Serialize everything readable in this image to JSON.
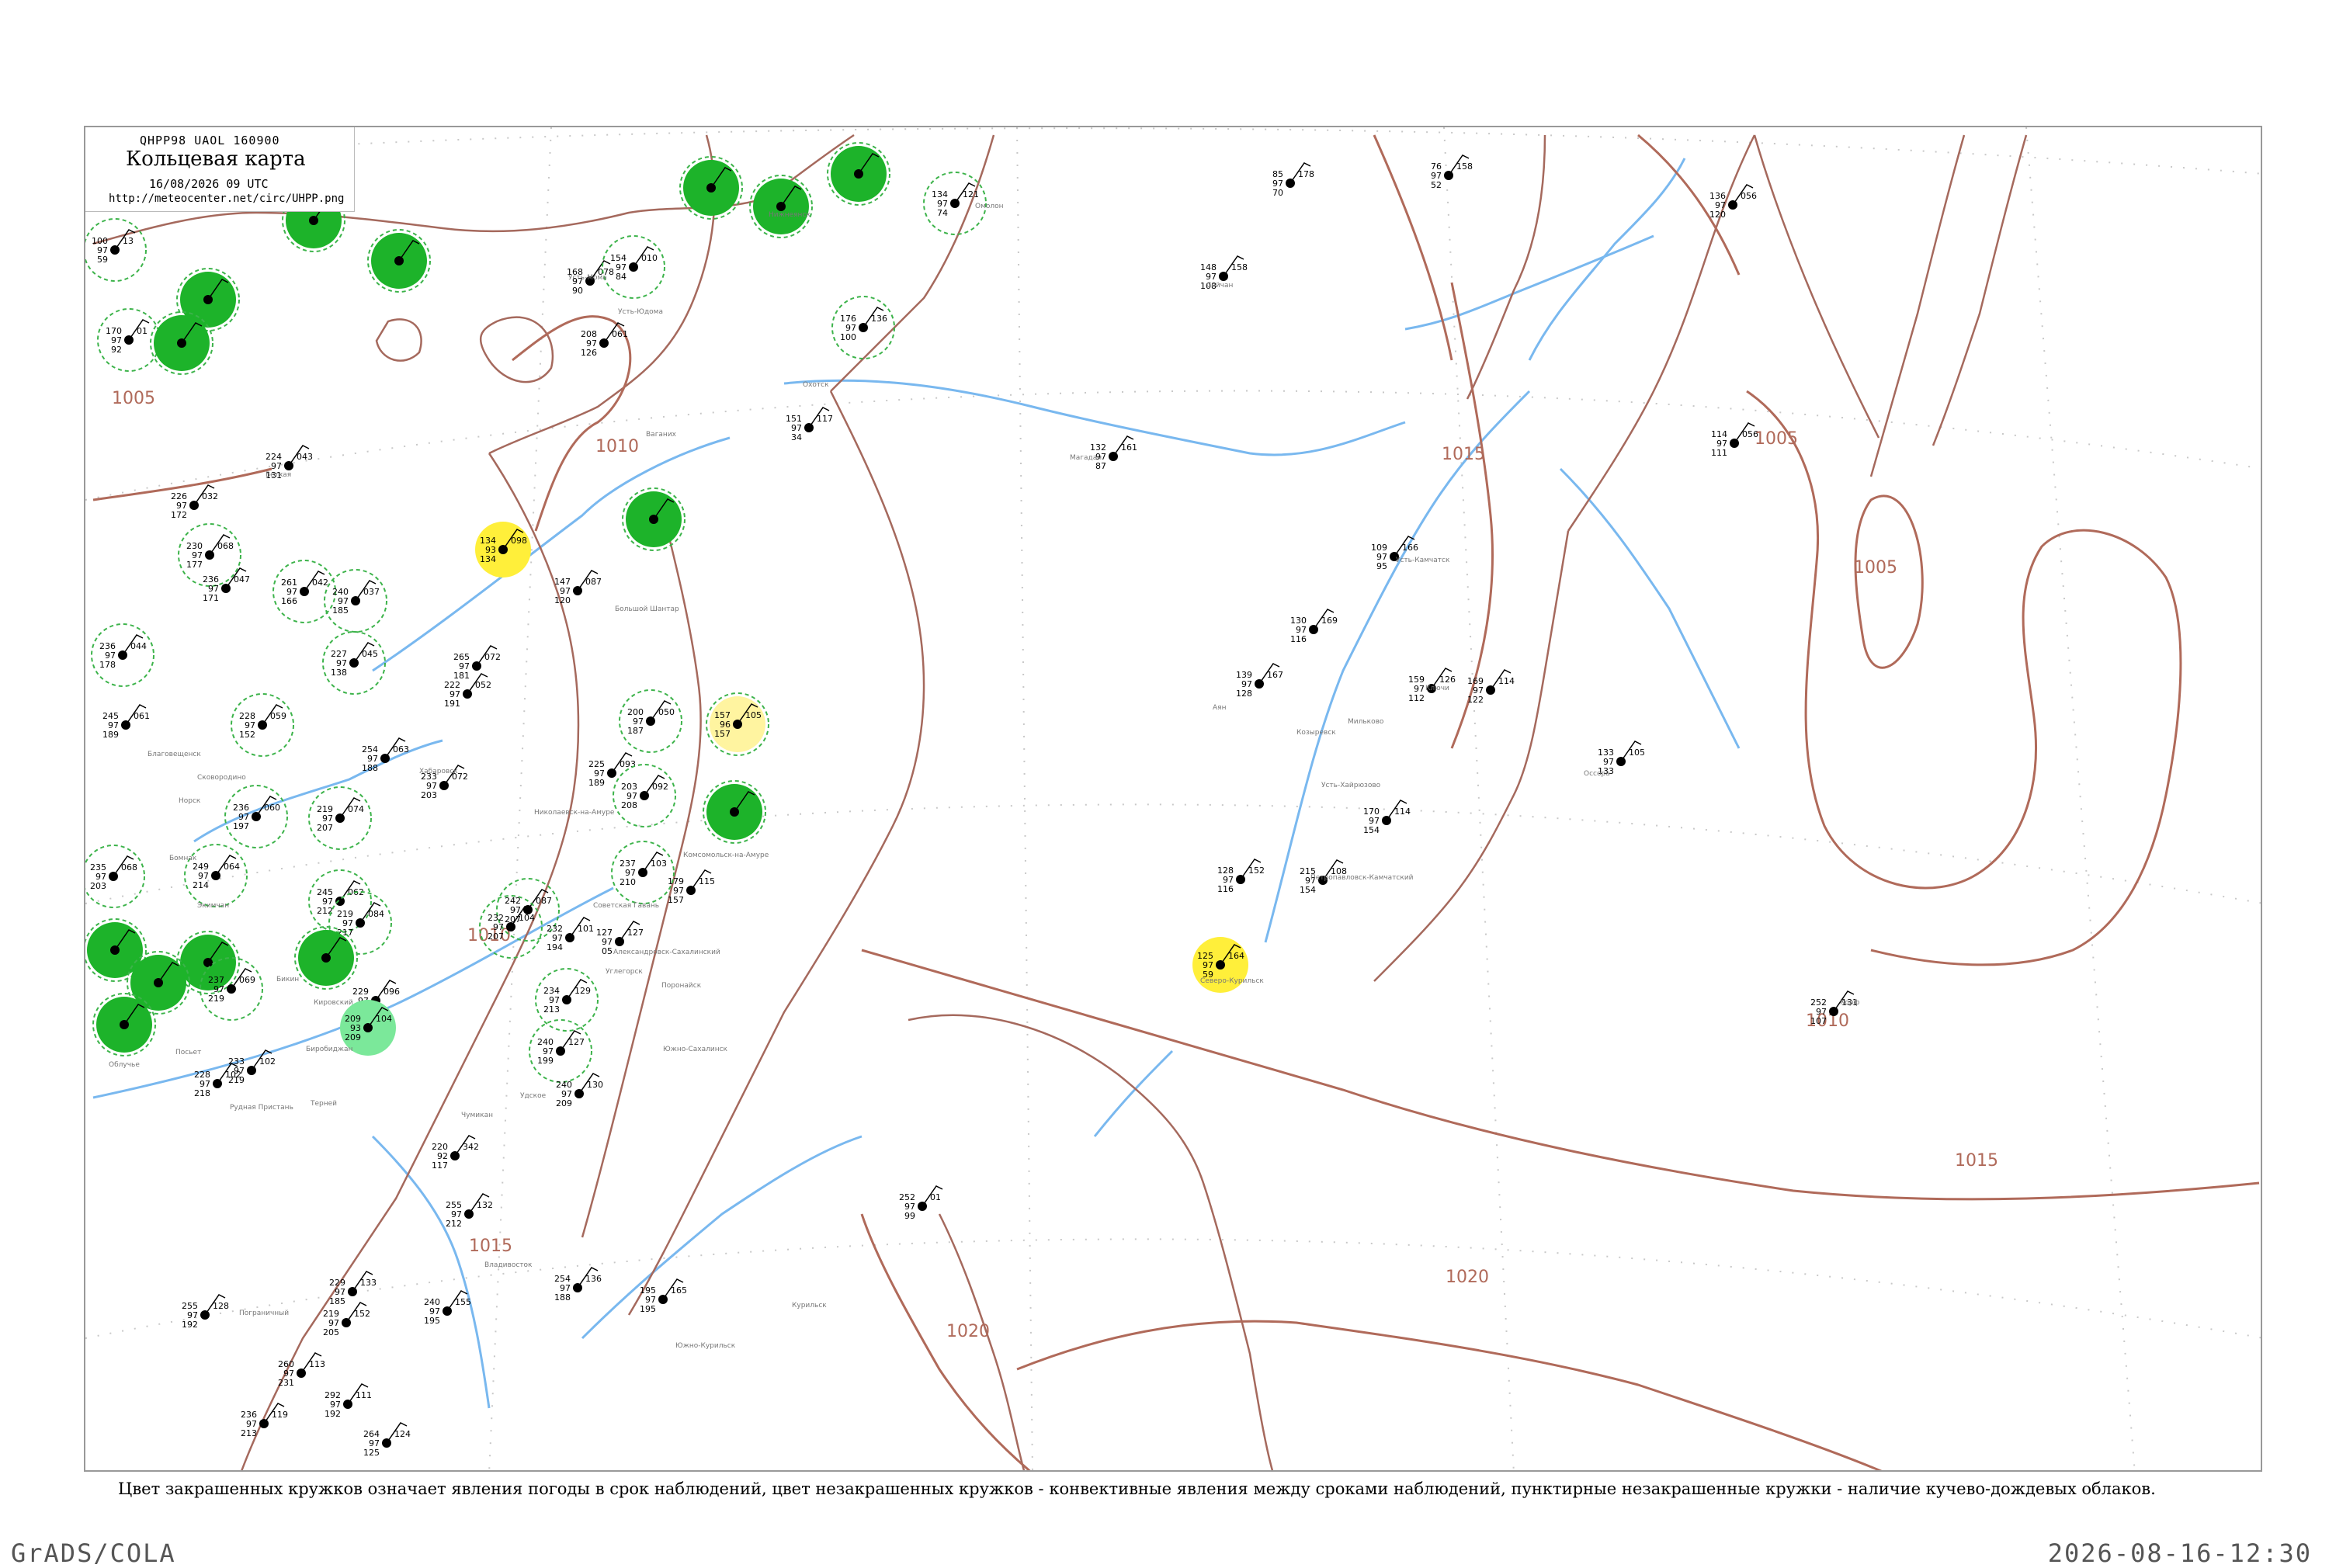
{
  "header": {
    "code": "QHPP98  UAOL  160900",
    "title": "Кольцевая карта",
    "datetime": "16/08/2026 09 UTC",
    "url": "http://meteocenter.net/circ/UHPP.png"
  },
  "caption": "Цвет закрашенных кружков означает явления погоды в срок наблюдений, цвет незакрашенных кружков - конвективные явления между сроками наблюдений, пунктирные незакрашенные кружки - наличие кучево-дождевых облаков.",
  "footer": {
    "left": "GrADS/COLA",
    "right": "2026-08-16-12:30"
  },
  "colors": {
    "frame": "#999999",
    "isobar": "#b06a5a",
    "coast": "#a5695d",
    "river": "#79b8ef",
    "grid": "#c8c8c8",
    "green_fill": "#1db32a",
    "yellow_fill": "#ffef3a",
    "light_green_fill": "#7be89a",
    "light_yellow_fill": "#fff4a0",
    "cb_ring": "#3cb34a"
  },
  "isobar_labels": [
    "1005",
    "1010",
    "1010",
    "1015",
    "1015",
    "1005",
    "1005",
    "1010",
    "1015",
    "1020",
    "1020"
  ],
  "stations": [
    {
      "t": "100",
      "w": "13",
      "h": "97",
      "v": "59",
      "fill": "none",
      "ring": "cb"
    },
    {
      "t": "170",
      "w": "01",
      "h": "97",
      "v": "92",
      "fill": "none",
      "ring": "cb"
    },
    {
      "t": "",
      "w": "",
      "h": "",
      "v": "",
      "fill": "green",
      "ring": "cb"
    },
    {
      "t": "",
      "w": "",
      "h": "",
      "v": "",
      "fill": "green",
      "ring": "cb"
    },
    {
      "t": "",
      "w": "",
      "h": "",
      "v": "",
      "fill": "green",
      "ring": "cb"
    },
    {
      "t": "134",
      "w": "121",
      "h": "97",
      "v": "74",
      "fill": "none",
      "ring": "cb"
    },
    {
      "t": "",
      "w": "",
      "h": "",
      "v": "",
      "fill": "green",
      "ring": "cb"
    },
    {
      "t": "",
      "w": "",
      "h": "",
      "v": "",
      "fill": "green",
      "ring": "cb"
    },
    {
      "t": "",
      "w": "",
      "h": "",
      "v": "",
      "fill": "green",
      "ring": "cb"
    },
    {
      "t": "",
      "w": "",
      "h": "",
      "v": "",
      "fill": "green",
      "ring": "cb"
    },
    {
      "t": "168",
      "w": "078",
      "h": "97",
      "v": "90",
      "fill": "none",
      "ring": "none"
    },
    {
      "t": "154",
      "w": "010",
      "h": "97",
      "v": "84",
      "fill": "none",
      "ring": "cb"
    },
    {
      "t": "208",
      "w": "061",
      "h": "97",
      "v": "126",
      "fill": "none",
      "ring": "none"
    },
    {
      "t": "176",
      "w": "136",
      "h": "97",
      "v": "100",
      "fill": "none",
      "ring": "cb"
    },
    {
      "t": "151",
      "w": "117",
      "h": "97",
      "v": "34",
      "fill": "none",
      "ring": "none"
    },
    {
      "t": "85",
      "w": "178",
      "h": "97",
      "v": "70",
      "fill": "none",
      "ring": "none"
    },
    {
      "t": "76",
      "w": "158",
      "h": "97",
      "v": "52",
      "fill": "none",
      "ring": "none"
    },
    {
      "t": "136",
      "w": "056",
      "h": "97",
      "v": "120",
      "fill": "none",
      "ring": "none"
    },
    {
      "t": "148",
      "w": "158",
      "h": "97",
      "v": "108",
      "fill": "none",
      "ring": "none"
    },
    {
      "t": "132",
      "w": "161",
      "h": "97",
      "v": "87",
      "fill": "none",
      "ring": "none"
    },
    {
      "t": "114",
      "w": "056",
      "h": "97",
      "v": "111",
      "fill": "none",
      "ring": "none"
    },
    {
      "t": "226",
      "w": "032",
      "h": "97",
      "v": "172",
      "fill": "none",
      "ring": "none"
    },
    {
      "t": "224",
      "w": "043",
      "h": "97",
      "v": "131",
      "fill": "none",
      "ring": "none"
    },
    {
      "t": "134",
      "w": "098",
      "h": "93",
      "v": "134",
      "fill": "yellow",
      "ring": "none"
    },
    {
      "t": "",
      "w": "",
      "h": "",
      "v": "",
      "fill": "green",
      "ring": "cb"
    },
    {
      "t": "147",
      "w": "087",
      "h": "97",
      "v": "120",
      "fill": "none",
      "ring": "none"
    },
    {
      "t": "230",
      "w": "068",
      "h": "97",
      "v": "177",
      "fill": "none",
      "ring": "cb"
    },
    {
      "t": "236",
      "w": "047",
      "h": "97",
      "v": "171",
      "fill": "none",
      "ring": "none"
    },
    {
      "t": "261",
      "w": "042",
      "h": "97",
      "v": "166",
      "fill": "none",
      "ring": "cb"
    },
    {
      "t": "240",
      "w": "037",
      "h": "97",
      "v": "185",
      "fill": "none",
      "ring": "cb"
    },
    {
      "t": "236",
      "w": "044",
      "h": "97",
      "v": "178",
      "fill": "none",
      "ring": "cb"
    },
    {
      "t": "227",
      "w": "045",
      "h": "97",
      "v": "138",
      "fill": "none",
      "ring": "cb"
    },
    {
      "t": "265",
      "w": "072",
      "h": "97",
      "v": "181",
      "fill": "none",
      "ring": "none"
    },
    {
      "t": "222",
      "w": "052",
      "h": "97",
      "v": "191",
      "fill": "none",
      "ring": "none"
    },
    {
      "t": "109",
      "w": "166",
      "h": "97",
      "v": "95",
      "fill": "none",
      "ring": "none"
    },
    {
      "t": "130",
      "w": "169",
      "h": "97",
      "v": "116",
      "fill": "none",
      "ring": "none"
    },
    {
      "t": "159",
      "w": "126",
      "h": "97",
      "v": "112",
      "fill": "none",
      "ring": "none"
    },
    {
      "t": "169",
      "w": "114",
      "h": "97",
      "v": "122",
      "fill": "none",
      "ring": "none"
    },
    {
      "t": "139",
      "w": "167",
      "h": "97",
      "v": "128",
      "fill": "none",
      "ring": "none"
    },
    {
      "t": "200",
      "w": "050",
      "h": "97",
      "v": "187",
      "fill": "none",
      "ring": "cb"
    },
    {
      "t": "157",
      "w": "105",
      "h": "96",
      "v": "157",
      "fill": "light-yellow",
      "ring": "cb"
    },
    {
      "t": "133",
      "w": "105",
      "h": "97",
      "v": "133",
      "fill": "none",
      "ring": "none"
    },
    {
      "t": "228",
      "w": "059",
      "h": "97",
      "v": "152",
      "fill": "none",
      "ring": "cb"
    },
    {
      "t": "254",
      "w": "063",
      "h": "97",
      "v": "188",
      "fill": "none",
      "ring": "none"
    },
    {
      "t": "225",
      "w": "093",
      "h": "97",
      "v": "189",
      "fill": "none",
      "ring": "none"
    },
    {
      "t": "203",
      "w": "092",
      "h": "97",
      "v": "208",
      "fill": "none",
      "ring": "cb"
    },
    {
      "t": "233",
      "w": "072",
      "h": "97",
      "v": "203",
      "fill": "none",
      "ring": "none"
    },
    {
      "t": "245",
      "w": "061",
      "h": "97",
      "v": "189",
      "fill": "none",
      "ring": "none"
    },
    {
      "t": "219",
      "w": "074",
      "h": "97",
      "v": "207",
      "fill": "none",
      "ring": "cb"
    },
    {
      "t": "236",
      "w": "060",
      "h": "97",
      "v": "197",
      "fill": "none",
      "ring": "cb"
    },
    {
      "t": "",
      "w": "",
      "h": "",
      "v": "",
      "fill": "green",
      "ring": "cb"
    },
    {
      "t": "170",
      "w": "114",
      "h": "97",
      "v": "154",
      "fill": "none",
      "ring": "none"
    },
    {
      "t": "235",
      "w": "068",
      "h": "97",
      "v": "203",
      "fill": "none",
      "ring": "cb"
    },
    {
      "t": "249",
      "w": "064",
      "h": "97",
      "v": "214",
      "fill": "none",
      "ring": "cb"
    },
    {
      "t": "237",
      "w": "103",
      "h": "97",
      "v": "210",
      "fill": "none",
      "ring": "cb"
    },
    {
      "t": "179",
      "w": "115",
      "h": "97",
      "v": "157",
      "fill": "none",
      "ring": "none"
    },
    {
      "t": "128",
      "w": "152",
      "h": "97",
      "v": "116",
      "fill": "none",
      "ring": "none"
    },
    {
      "t": "215",
      "w": "108",
      "h": "97",
      "v": "154",
      "fill": "none",
      "ring": "none"
    },
    {
      "t": "245",
      "w": "062",
      "h": "97",
      "v": "212",
      "fill": "none",
      "ring": "cb"
    },
    {
      "t": "219",
      "w": "084",
      "h": "97",
      "v": "217",
      "fill": "none",
      "ring": "cb"
    },
    {
      "t": "242",
      "w": "087",
      "h": "97",
      "v": "207",
      "fill": "none",
      "ring": "cb"
    },
    {
      "t": "",
      "w": "",
      "h": "",
      "v": "",
      "fill": "green",
      "ring": "cb"
    },
    {
      "t": "",
      "w": "",
      "h": "",
      "v": "",
      "fill": "green",
      "ring": "cb"
    },
    {
      "t": "",
      "w": "",
      "h": "",
      "v": "",
      "fill": "green",
      "ring": "cb"
    },
    {
      "t": "232",
      "w": "104",
      "h": "97",
      "v": "207",
      "fill": "none",
      "ring": "cb"
    },
    {
      "t": "232",
      "w": "101",
      "h": "97",
      "v": "194",
      "fill": "none",
      "ring": "none"
    },
    {
      "t": "127",
      "w": "127",
      "h": "97",
      "v": "05",
      "fill": "none",
      "ring": "none"
    },
    {
      "t": "125",
      "w": "164",
      "h": "97",
      "v": "59",
      "fill": "yellow",
      "ring": "none"
    },
    {
      "t": "252",
      "w": "131",
      "h": "97",
      "v": "107",
      "fill": "none",
      "ring": "none"
    },
    {
      "t": "229",
      "w": "096",
      "h": "97",
      "v": "227",
      "fill": "none",
      "ring": "none"
    },
    {
      "t": "",
      "w": "",
      "h": "",
      "v": "",
      "fill": "green",
      "ring": "cb"
    },
    {
      "t": "237",
      "w": "069",
      "h": "97",
      "v": "219",
      "fill": "none",
      "ring": "cb"
    },
    {
      "t": "",
      "w": "",
      "h": "",
      "v": "",
      "fill": "green",
      "ring": "cb"
    },
    {
      "t": "209",
      "w": "104",
      "h": "93",
      "v": "209",
      "fill": "light-green",
      "ring": "none"
    },
    {
      "t": "234",
      "w": "129",
      "h": "97",
      "v": "213",
      "fill": "none",
      "ring": "cb"
    },
    {
      "t": "240",
      "w": "127",
      "h": "97",
      "v": "199",
      "fill": "none",
      "ring": "cb"
    },
    {
      "t": "233",
      "w": "102",
      "h": "97",
      "v": "219",
      "fill": "none",
      "ring": "none"
    },
    {
      "t": "228",
      "w": "102",
      "h": "97",
      "v": "218",
      "fill": "none",
      "ring": "none"
    },
    {
      "t": "240",
      "w": "130",
      "h": "97",
      "v": "209",
      "fill": "none",
      "ring": "none"
    },
    {
      "t": "220",
      "w": "342",
      "h": "92",
      "v": "117",
      "fill": "none",
      "ring": "none"
    },
    {
      "t": "255",
      "w": "132",
      "h": "97",
      "v": "212",
      "fill": "none",
      "ring": "none"
    },
    {
      "t": "252",
      "w": "01",
      "h": "97",
      "v": "99",
      "fill": "none",
      "ring": "none"
    },
    {
      "t": "254",
      "w": "136",
      "h": "97",
      "v": "188",
      "fill": "none",
      "ring": "none"
    },
    {
      "t": "195",
      "w": "165",
      "h": "97",
      "v": "195",
      "fill": "none",
      "ring": "none"
    },
    {
      "t": "229",
      "w": "133",
      "h": "97",
      "v": "185",
      "fill": "none",
      "ring": "none"
    },
    {
      "t": "240",
      "w": "155",
      "h": "97",
      "v": "195",
      "fill": "none",
      "ring": "none"
    },
    {
      "t": "219",
      "w": "152",
      "h": "97",
      "v": "205",
      "fill": "none",
      "ring": "none"
    },
    {
      "t": "255",
      "w": "128",
      "h": "97",
      "v": "192",
      "fill": "none",
      "ring": "none"
    },
    {
      "t": "260",
      "w": "113",
      "h": "97",
      "v": "231",
      "fill": "none",
      "ring": "none"
    },
    {
      "t": "236",
      "w": "119",
      "h": "97",
      "v": "213",
      "fill": "none",
      "ring": "none"
    },
    {
      "t": "292",
      "w": "111",
      "h": "97",
      "v": "192",
      "fill": "none",
      "ring": "none"
    },
    {
      "t": "264",
      "w": "124",
      "h": "97",
      "v": "125",
      "fill": "none",
      "ring": "none"
    }
  ],
  "place_names": [
    "Усть-Мома",
    "Усть-Юдома",
    "Ветхая",
    "Ваганих",
    "Магадан",
    "Омолон",
    "Сейчан",
    "Большой Шантар",
    "Нижнеянск",
    "Охотск",
    "Аян",
    "Усть-Камчатск",
    "Ключи",
    "Мильково",
    "Козыревск",
    "Усть-Хайрюзово",
    "Петропавловск-Камчатский",
    "Корф",
    "Оссора",
    "Николаевск-на-Амуре",
    "Комсомольск-на-Амуре",
    "Хабаровск",
    "Советская Гавань",
    "Александровск-Сахалинский",
    "Поронайск",
    "Южно-Сахалинск",
    "Углегорск",
    "Курильск",
    "Северо-Курильск",
    "Южно-Курильск",
    "Владивосток",
    "Рудная Пристань",
    "Посьет",
    "Терней",
    "Кировский",
    "Бикин",
    "Экимчан",
    "Бомнак",
    "Норск",
    "Сковородино",
    "Благовещенск",
    "Биробиджан",
    "Облучье",
    "Пограничный",
    "Чумикан",
    "Удское"
  ]
}
